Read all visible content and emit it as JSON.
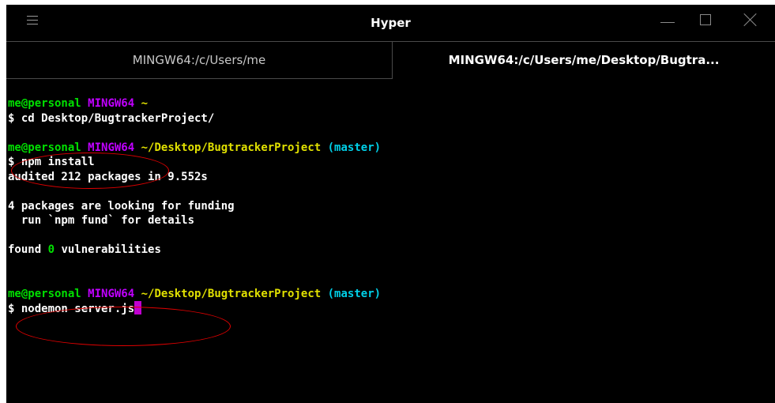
{
  "window": {
    "title": "Hyper"
  },
  "tabs": [
    {
      "label": "MINGW64:/c/Users/me",
      "active": false
    },
    {
      "label": "MINGW64:/c/Users/me/Desktop/Bugtra...",
      "active": true
    }
  ],
  "terminal": {
    "block1": {
      "user": "me@personal",
      "shell": "MINGW64",
      "path": "~",
      "command": "$ cd Desktop/BugtrackerProject/"
    },
    "block2": {
      "user": "me@personal",
      "shell": "MINGW64",
      "path": "~/Desktop/BugtrackerProject",
      "branch": "(master)",
      "command": "$ npm install",
      "out1": "audited 212 packages in 9.552s",
      "out2": "4 packages are looking for funding",
      "out3": "  run `npm fund` for details",
      "out4_pre": "found ",
      "out4_num": "0",
      "out4_post": " vulnerabilities"
    },
    "block3": {
      "user": "me@personal",
      "shell": "MINGW64",
      "path": "~/Desktop/BugtrackerProject",
      "branch": "(master)",
      "command": "$ nodemon server.js"
    }
  },
  "colors": {
    "user": "#00e000",
    "shell": "#c000ff",
    "path": "#e0e000",
    "branch": "#00d0e8",
    "annotation": "#e00000"
  }
}
